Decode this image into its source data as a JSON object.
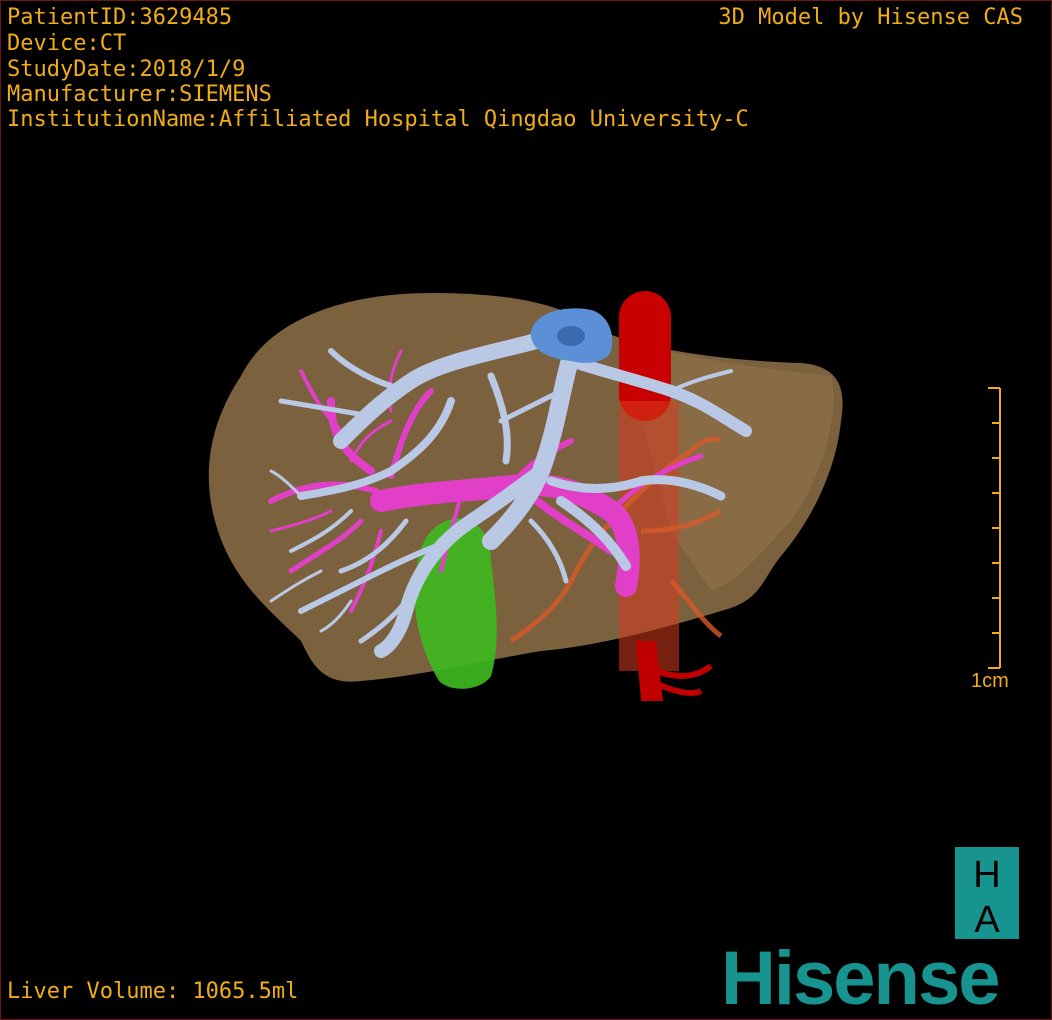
{
  "header": {
    "patient_id": "PatientID:3629485",
    "device": "Device:CT",
    "study_date": "StudyDate:2018/1/9",
    "manufacturer": "Manufacturer:SIEMENS",
    "institution": "InstitutionName:Affiliated Hospital Qingdao University-C"
  },
  "brand": {
    "caption": "3D Model by Hisense CAS",
    "ha_top": "H",
    "ha_bottom": "A",
    "wordmark": "Hisense"
  },
  "scale": {
    "label": "1cm"
  },
  "footer": {
    "volume": "Liver Volume: 1065.5ml"
  },
  "colors": {
    "overlay_text": "#f0ad14",
    "liver": "#8a6b45",
    "portal_vein": "#b9c8e4",
    "hepatic_vein": "#e23fc8",
    "ivc": "#c80000",
    "gallbladder": "#3fb820",
    "hepatic_confluence": "#5b8fd6",
    "artery": "#d85a2a",
    "brand_teal": "#17948f"
  }
}
